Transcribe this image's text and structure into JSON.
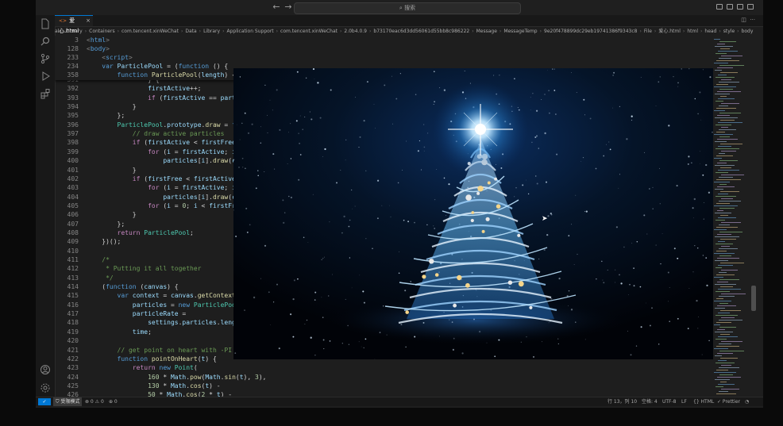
{
  "titlebar": {
    "search_placeholder": "搜索",
    "back_glyph": "←",
    "forward_glyph": "→"
  },
  "activity": {
    "icons": [
      "files-icon",
      "search-icon",
      "source-control-icon",
      "run-debug-icon",
      "extensions-icon"
    ],
    "bottom_icons": [
      "account-icon",
      "settings-gear-icon"
    ]
  },
  "tabs": {
    "active": {
      "tag": "<>",
      "label": "爱心.html",
      "close": "×"
    }
  },
  "breadcrumb": [
    "al",
    "Library",
    "Containers",
    "com.tencent.xinWeChat",
    "Data",
    "Library",
    "Application Support",
    "com.tencent.xinWeChat",
    "2.0b4.0.9",
    "b73170eac6d3dd56061d55bb8c986222",
    "Message",
    "MessageTemp",
    "9e20f478899dc29eb19741386f9343c8",
    "File",
    "爱心.html",
    "html",
    "head",
    "style",
    "body"
  ],
  "sticky_lines": [
    {
      "num": "3",
      "indent": 0,
      "code": [
        [
          "tagc",
          "<"
        ],
        [
          "tagn",
          "html"
        ],
        [
          "tagc",
          ">"
        ]
      ]
    },
    {
      "num": "128",
      "indent": 0,
      "code": [
        [
          "tagc",
          "<"
        ],
        [
          "tagn",
          "body"
        ],
        [
          "tagc",
          ">"
        ]
      ]
    },
    {
      "num": "233",
      "indent": 4,
      "code": [
        [
          "tagc",
          "<"
        ],
        [
          "tagn",
          "script"
        ],
        [
          "tagc",
          ">"
        ]
      ]
    },
    {
      "num": "234",
      "indent": 4,
      "code": [
        [
          "kw",
          "var "
        ],
        [
          "var",
          "ParticlePool"
        ],
        [
          "pl",
          " = ("
        ],
        [
          "kw",
          "function"
        ],
        [
          "pl",
          " () {"
        ]
      ]
    },
    {
      "num": "358",
      "indent": 8,
      "code": [
        [
          "kw",
          "function "
        ],
        [
          "fn",
          "ParticlePool"
        ],
        [
          "pl",
          "("
        ],
        [
          "var",
          "length"
        ],
        [
          "pl",
          ") {"
        ]
      ]
    }
  ],
  "code_lines": [
    {
      "num": "391",
      "indent": 16,
      "code": [
        [
          "pl",
          "} {"
        ]
      ]
    },
    {
      "num": "392",
      "indent": 16,
      "code": [
        [
          "var",
          "firstActive"
        ],
        [
          "pl",
          "++;"
        ]
      ]
    },
    {
      "num": "393",
      "indent": 16,
      "code": [
        [
          "ctl",
          "if"
        ],
        [
          "pl",
          " ("
        ],
        [
          "var",
          "firstActive"
        ],
        [
          "pl",
          " == "
        ],
        [
          "var",
          "partic"
        ]
      ]
    },
    {
      "num": "394",
      "indent": 12,
      "code": [
        [
          "pl",
          "}"
        ]
      ]
    },
    {
      "num": "395",
      "indent": 8,
      "code": [
        [
          "pl",
          "};"
        ]
      ]
    },
    {
      "num": "396",
      "indent": 8,
      "code": [
        [
          "cls",
          "ParticlePool"
        ],
        [
          "pl",
          "."
        ],
        [
          "var",
          "prototype"
        ],
        [
          "pl",
          "."
        ],
        [
          "fn",
          "draw"
        ],
        [
          "pl",
          " = "
        ],
        [
          "kw",
          "func"
        ]
      ]
    },
    {
      "num": "397",
      "indent": 12,
      "code": [
        [
          "cmt",
          "// draw active particles"
        ]
      ]
    },
    {
      "num": "398",
      "indent": 12,
      "code": [
        [
          "ctl",
          "if"
        ],
        [
          "pl",
          " ("
        ],
        [
          "var",
          "firstActive"
        ],
        [
          "pl",
          " < "
        ],
        [
          "var",
          "firstFree"
        ],
        [
          "pl",
          ")"
        ]
      ]
    },
    {
      "num": "399",
      "indent": 16,
      "code": [
        [
          "ctl",
          "for"
        ],
        [
          "pl",
          " ("
        ],
        [
          "var",
          "i"
        ],
        [
          "pl",
          " = "
        ],
        [
          "var",
          "firstActive"
        ],
        [
          "pl",
          "; "
        ],
        [
          "var",
          "i"
        ],
        [
          "pl",
          " <"
        ]
      ]
    },
    {
      "num": "400",
      "indent": 20,
      "code": [
        [
          "var",
          "particles"
        ],
        [
          "pl",
          "["
        ],
        [
          "var",
          "i"
        ],
        [
          "pl",
          "]."
        ],
        [
          "fn",
          "draw"
        ],
        [
          "pl",
          "("
        ],
        [
          "var",
          "con"
        ]
      ]
    },
    {
      "num": "401",
      "indent": 12,
      "code": [
        [
          "pl",
          "}"
        ]
      ]
    },
    {
      "num": "402",
      "indent": 12,
      "code": [
        [
          "ctl",
          "if"
        ],
        [
          "pl",
          " ("
        ],
        [
          "var",
          "firstFree"
        ],
        [
          "pl",
          " < "
        ],
        [
          "var",
          "firstActive"
        ],
        [
          "pl",
          ")"
        ]
      ]
    },
    {
      "num": "403",
      "indent": 16,
      "code": [
        [
          "ctl",
          "for"
        ],
        [
          "pl",
          " ("
        ],
        [
          "var",
          "i"
        ],
        [
          "pl",
          " = "
        ],
        [
          "var",
          "firstActive"
        ],
        [
          "pl",
          "; "
        ],
        [
          "var",
          "i"
        ],
        [
          "pl",
          " <"
        ]
      ]
    },
    {
      "num": "404",
      "indent": 20,
      "code": [
        [
          "var",
          "particles"
        ],
        [
          "pl",
          "["
        ],
        [
          "var",
          "i"
        ],
        [
          "pl",
          "]."
        ],
        [
          "fn",
          "draw"
        ],
        [
          "pl",
          "("
        ],
        [
          "var",
          "con"
        ]
      ]
    },
    {
      "num": "405",
      "indent": 16,
      "code": [
        [
          "ctl",
          "for"
        ],
        [
          "pl",
          " ("
        ],
        [
          "var",
          "i"
        ],
        [
          "pl",
          " = "
        ],
        [
          "num",
          "0"
        ],
        [
          "pl",
          "; "
        ],
        [
          "var",
          "i"
        ],
        [
          "pl",
          " < "
        ],
        [
          "var",
          "firstFree"
        ]
      ]
    },
    {
      "num": "406",
      "indent": 12,
      "code": [
        [
          "pl",
          "}"
        ]
      ]
    },
    {
      "num": "407",
      "indent": 8,
      "code": [
        [
          "pl",
          "};"
        ]
      ]
    },
    {
      "num": "408",
      "indent": 8,
      "code": [
        [
          "ctl",
          "return "
        ],
        [
          "cls",
          "ParticlePool"
        ],
        [
          "pl",
          ";"
        ]
      ]
    },
    {
      "num": "409",
      "indent": 4,
      "code": [
        [
          "pl",
          "})();"
        ]
      ]
    },
    {
      "num": "410",
      "indent": 0,
      "code": []
    },
    {
      "num": "411",
      "indent": 4,
      "code": [
        [
          "cmt",
          "/*"
        ]
      ]
    },
    {
      "num": "412",
      "indent": 4,
      "code": [
        [
          "cmt",
          " * Putting it all together"
        ]
      ]
    },
    {
      "num": "413",
      "indent": 4,
      "code": [
        [
          "cmt",
          " */"
        ]
      ]
    },
    {
      "num": "414",
      "indent": 4,
      "code": [
        [
          "pl",
          "("
        ],
        [
          "kw",
          "function"
        ],
        [
          "pl",
          " ("
        ],
        [
          "var",
          "canvas"
        ],
        [
          "pl",
          ") {"
        ]
      ]
    },
    {
      "num": "415",
      "indent": 8,
      "code": [
        [
          "kw",
          "var "
        ],
        [
          "var",
          "context"
        ],
        [
          "pl",
          " = "
        ],
        [
          "var",
          "canvas"
        ],
        [
          "pl",
          "."
        ],
        [
          "fn",
          "getContext"
        ],
        [
          "pl",
          "(\""
        ]
      ]
    },
    {
      "num": "416",
      "indent": 12,
      "code": [
        [
          "var",
          "particles"
        ],
        [
          "pl",
          " = "
        ],
        [
          "kw",
          "new "
        ],
        [
          "cls",
          "ParticlePool"
        ],
        [
          "pl",
          "("
        ]
      ]
    },
    {
      "num": "417",
      "indent": 12,
      "code": [
        [
          "var",
          "particleRate"
        ],
        [
          "pl",
          " ="
        ]
      ]
    },
    {
      "num": "418",
      "indent": 16,
      "code": [
        [
          "var",
          "settings"
        ],
        [
          "pl",
          "."
        ],
        [
          "var",
          "particles"
        ],
        [
          "pl",
          "."
        ],
        [
          "var",
          "length"
        ]
      ]
    },
    {
      "num": "419",
      "indent": 12,
      "code": [
        [
          "var",
          "time"
        ],
        [
          "pl",
          ";"
        ]
      ]
    },
    {
      "num": "420",
      "indent": 0,
      "code": []
    },
    {
      "num": "421",
      "indent": 8,
      "code": [
        [
          "cmt",
          "// get point on heart with -PI <="
        ]
      ]
    },
    {
      "num": "422",
      "indent": 8,
      "code": [
        [
          "kw",
          "function "
        ],
        [
          "fn",
          "pointOnHeart"
        ],
        [
          "pl",
          "("
        ],
        [
          "var",
          "t"
        ],
        [
          "pl",
          ") {"
        ]
      ]
    },
    {
      "num": "423",
      "indent": 12,
      "code": [
        [
          "ctl",
          "return "
        ],
        [
          "kw",
          "new "
        ],
        [
          "cls",
          "Point"
        ],
        [
          "pl",
          "("
        ]
      ]
    },
    {
      "num": "424",
      "indent": 16,
      "code": [
        [
          "num",
          "160"
        ],
        [
          "pl",
          " * "
        ],
        [
          "var",
          "Math"
        ],
        [
          "pl",
          "."
        ],
        [
          "fn",
          "pow"
        ],
        [
          "pl",
          "("
        ],
        [
          "var",
          "Math"
        ],
        [
          "pl",
          "."
        ],
        [
          "fn",
          "sin"
        ],
        [
          "pl",
          "("
        ],
        [
          "var",
          "t"
        ],
        [
          "pl",
          "), "
        ],
        [
          "num",
          "3"
        ],
        [
          "pl",
          "),"
        ]
      ]
    },
    {
      "num": "425",
      "indent": 16,
      "code": [
        [
          "num",
          "130"
        ],
        [
          "pl",
          " * "
        ],
        [
          "var",
          "Math"
        ],
        [
          "pl",
          "."
        ],
        [
          "fn",
          "cos"
        ],
        [
          "pl",
          "("
        ],
        [
          "var",
          "t"
        ],
        [
          "pl",
          ") -"
        ]
      ]
    },
    {
      "num": "426",
      "indent": 16,
      "code": [
        [
          "num",
          "50"
        ],
        [
          "pl",
          " * "
        ],
        [
          "var",
          "Math"
        ],
        [
          "pl",
          "."
        ],
        [
          "fn",
          "cos"
        ],
        [
          "pl",
          "("
        ],
        [
          "num",
          "2"
        ],
        [
          "pl",
          " * "
        ],
        [
          "var",
          "t"
        ],
        [
          "pl",
          ") -"
        ]
      ]
    }
  ],
  "statusbar": {
    "remote": "✓",
    "mode": "受限模式",
    "errors": "⊗ 0 ⚠ 0",
    "ports": "⊕ 0",
    "position": "行 13，列 10",
    "spaces": "空格: 4",
    "encoding": "UTF-8",
    "eol": "LF",
    "language": "{} HTML",
    "formatter": "✓ Prettier",
    "bell": "🔔"
  },
  "video": {
    "description_icon": "christmas-tree-video"
  }
}
